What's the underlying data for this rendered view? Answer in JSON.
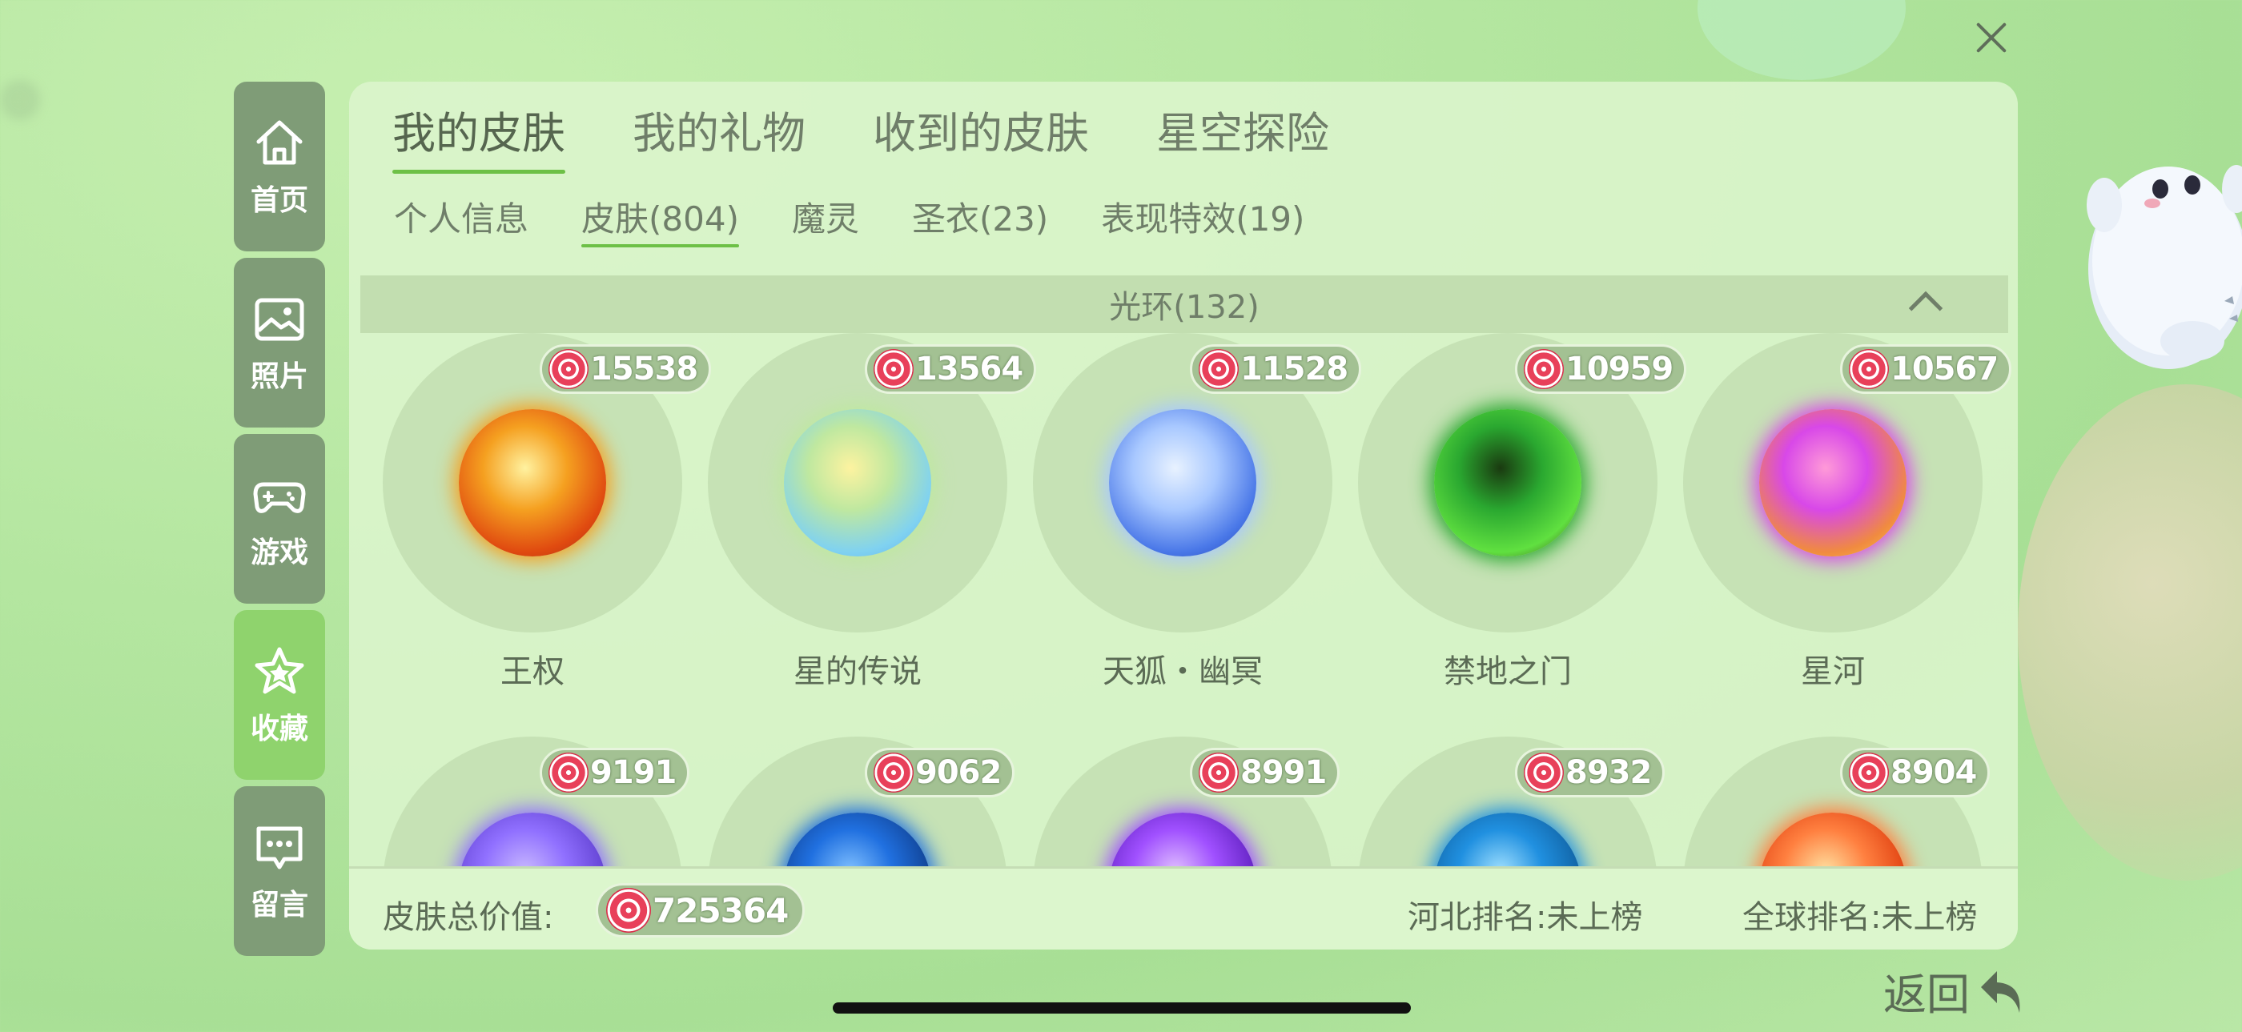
{
  "nav": [
    {
      "label": "首页",
      "icon": "home-icon",
      "active": false
    },
    {
      "label": "照片",
      "icon": "photo-icon",
      "active": false
    },
    {
      "label": "游戏",
      "icon": "gamepad-icon",
      "active": false
    },
    {
      "label": "收藏",
      "icon": "star-icon",
      "active": true
    },
    {
      "label": "留言",
      "icon": "message-icon",
      "active": false
    }
  ],
  "tabs": [
    {
      "label": "我的皮肤",
      "active": true
    },
    {
      "label": "我的礼物",
      "active": false
    },
    {
      "label": "收到的皮肤",
      "active": false
    },
    {
      "label": "星空探险",
      "active": false
    }
  ],
  "subtabs": [
    {
      "label": "个人信息",
      "active": false
    },
    {
      "label": "皮肤(804)",
      "active": true
    },
    {
      "label": "魔灵",
      "active": false
    },
    {
      "label": "圣衣(23)",
      "active": false
    },
    {
      "label": "表现特效(19)",
      "active": false
    }
  ],
  "section": {
    "title": "光环(132)"
  },
  "items": [
    {
      "name": "王权",
      "price": "15538",
      "colors": [
        "#fff2a0",
        "#f5a020",
        "#e04a10",
        "#a02a10"
      ]
    },
    {
      "name": "星的传说",
      "price": "13564",
      "colors": [
        "#fdf3a0",
        "#bfe8a0",
        "#80d2f0",
        "#5aa8f0"
      ]
    },
    {
      "name": "天狐・幽冥",
      "price": "11528",
      "colors": [
        "#e8f2ff",
        "#a8c8ff",
        "#4a78e8",
        "#1a3ab0"
      ]
    },
    {
      "name": "禁地之门",
      "price": "10959",
      "colors": [
        "#1a3a10",
        "#2aa830",
        "#60e040",
        "#3a2a18"
      ]
    },
    {
      "name": "星河",
      "price": "10567",
      "colors": [
        "#ff9ad8",
        "#d848e8",
        "#f08a40",
        "#ffd040"
      ]
    },
    {
      "name": "",
      "price": "9191",
      "colors": [
        "#c8b8ff",
        "#9070ff",
        "#6040d0",
        "#3020a0"
      ]
    },
    {
      "name": "",
      "price": "9062",
      "colors": [
        "#80c0ff",
        "#2070e0",
        "#104090",
        "#082050"
      ]
    },
    {
      "name": "",
      "price": "8991",
      "colors": [
        "#e0c0ff",
        "#a050ff",
        "#6020c0",
        "#300880"
      ]
    },
    {
      "name": "",
      "price": "8932",
      "colors": [
        "#a0e0ff",
        "#2090e0",
        "#1060a0",
        "#083060"
      ]
    },
    {
      "name": "",
      "price": "8904",
      "colors": [
        "#ffe0a0",
        "#ff8040",
        "#e04010",
        "#902010"
      ]
    }
  ],
  "footer": {
    "total_label": "皮肤总价值:",
    "total_value": "725364",
    "rank_hebei": "河北排名:未上榜",
    "rank_global": "全球排名:未上榜"
  },
  "back_label": "返回",
  "colors": {
    "accent": "#6dc046",
    "nav_bg": "#7f9c77",
    "nav_active": "#8fd36d"
  }
}
